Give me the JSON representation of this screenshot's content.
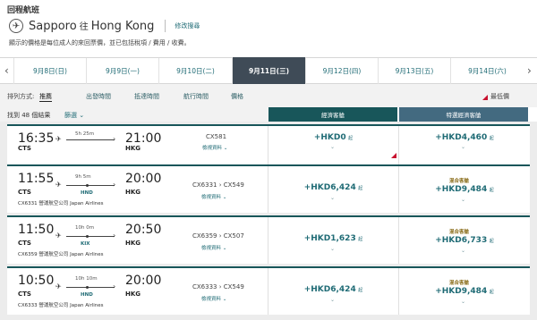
{
  "header": {
    "section_title": "回程航班",
    "origin": "Sapporo",
    "connector": "往",
    "destination": "Hong Kong",
    "modify_link": "修改搜尋",
    "note": "顯示的價格是每位成人的來回票價，並已包括稅項 / 費用 / 收費。"
  },
  "date_tabs": [
    {
      "label": "9月8日(日)",
      "active": false
    },
    {
      "label": "9月9日(一)",
      "active": false
    },
    {
      "label": "9月10日(二)",
      "active": false
    },
    {
      "label": "9月11日(三)",
      "active": true
    },
    {
      "label": "9月12日(四)",
      "active": false
    },
    {
      "label": "9月13日(五)",
      "active": false
    },
    {
      "label": "9月14日(六)",
      "active": false
    }
  ],
  "sort": {
    "label": "排列方式:",
    "options": [
      "推薦",
      "出發時間",
      "抵達時間",
      "航行時間",
      "價格"
    ],
    "legend": "最低價"
  },
  "results": {
    "count": "找到 48 個結果",
    "filter": "篩選"
  },
  "columns": {
    "economy": "經濟客艙",
    "premium": "特選經濟客艙"
  },
  "flights": [
    {
      "dep_time": "16:35",
      "dep_airport": "CTS",
      "arr_time": "21:00",
      "arr_airport": "HKG",
      "duration": "5h 25m",
      "via": "",
      "flight_no": "CX581",
      "operator": "",
      "detail": "檢視資料",
      "economy_price": "+HKD0",
      "economy_mixed": "",
      "premium_price": "+HKD4,460",
      "premium_mixed": "",
      "lowest": true
    },
    {
      "dep_time": "11:55",
      "dep_airport": "CTS",
      "arr_time": "20:00",
      "arr_airport": "HKG",
      "duration": "9h 5m",
      "via": "HND",
      "flight_no": "CX6331 › CX549",
      "operator": "CX6331 營運航空公司 Japan Airlines",
      "detail": "檢視資料",
      "economy_price": "+HKD6,424",
      "economy_mixed": "",
      "premium_price": "+HKD9,484",
      "premium_mixed": "混合客艙",
      "lowest": false
    },
    {
      "dep_time": "11:50",
      "dep_airport": "CTS",
      "arr_time": "20:50",
      "arr_airport": "HKG",
      "duration": "10h 0m",
      "via": "KIX",
      "flight_no": "CX6359 › CX507",
      "operator": "CX6359 營運航空公司 Japan Airlines",
      "detail": "檢視資料",
      "economy_price": "+HKD1,623",
      "economy_mixed": "",
      "premium_price": "+HKD6,733",
      "premium_mixed": "混合客艙",
      "lowest": false
    },
    {
      "dep_time": "10:50",
      "dep_airport": "CTS",
      "arr_time": "20:00",
      "arr_airport": "HKG",
      "duration": "10h 10m",
      "via": "HND",
      "flight_no": "CX6333 › CX549",
      "operator": "CX6333 營運航空公司 Japan Airlines",
      "detail": "檢視資料",
      "economy_price": "+HKD6,424",
      "economy_mixed": "",
      "premium_price": "+HKD9,484",
      "premium_mixed": "混合客艙",
      "lowest": false
    }
  ],
  "price_unit": "起",
  "colors": {
    "accent": "#18565a",
    "premium": "#436a80",
    "active_tab": "#3f4b57",
    "lowest_marker": "#c8102e"
  }
}
